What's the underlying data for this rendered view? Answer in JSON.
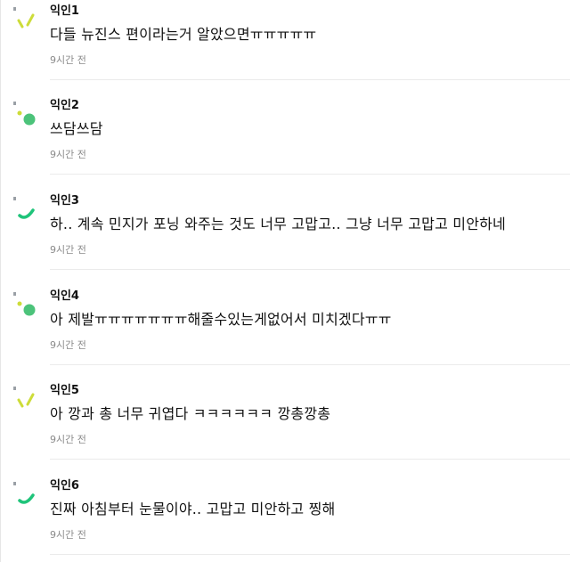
{
  "colors": {
    "avatar_yellow_green": "#cddc39",
    "avatar_green": "#4cc37a",
    "avatar_teal": "#1fc47a",
    "avatar_dot": "#9aa0a6",
    "time_text": "#8a8a8a"
  },
  "comments": [
    {
      "author": "익인1",
      "body": "다들 뉴진스 편이라는거 알았으면ㅠㅠㅠㅠㅠ",
      "time": "9시간 전",
      "avatar_icon": "slash-marks-icon"
    },
    {
      "author": "익인2",
      "body": "쓰담쓰담",
      "time": "9시간 전",
      "avatar_icon": "dot-circle-icon"
    },
    {
      "author": "익인3",
      "body": "하.. 계속 민지가 포닝 와주는 것도 너무 고맙고.. 그냥 너무 고맙고 미안하네",
      "time": "9시간 전",
      "avatar_icon": "smile-curve-icon"
    },
    {
      "author": "익인4",
      "body": "아 제발ㅠㅠㅠㅠㅠㅠㅠ해줄수있는게없어서 미치겠다ㅠㅠ",
      "time": "9시간 전",
      "avatar_icon": "dot-circle-icon"
    },
    {
      "author": "익인5",
      "body": "아 깡과 총 너무 귀엽다 ㅋㅋㅋㅋㅋㅋ 깡총깡총",
      "time": "9시간 전",
      "avatar_icon": "slash-marks-icon"
    },
    {
      "author": "익인6",
      "body": "진짜 아침부터 눈물이야.. 고맙고 미안하고 찡해",
      "time": "9시간 전",
      "avatar_icon": "smile-curve-icon"
    }
  ]
}
